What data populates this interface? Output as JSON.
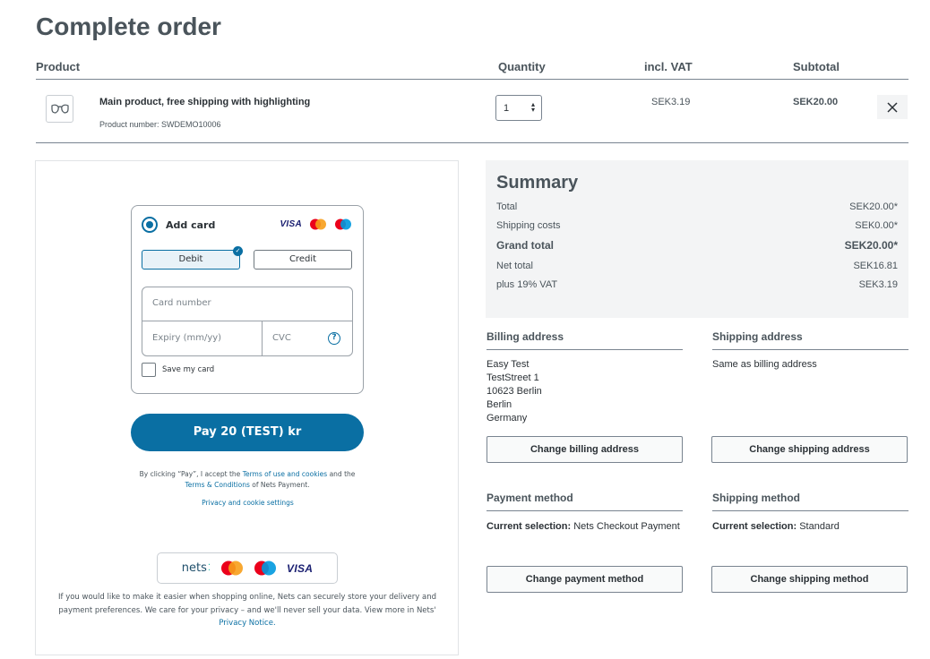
{
  "page": {
    "title": "Complete order"
  },
  "cart": {
    "headers": {
      "product": "Product",
      "quantity": "Quantity",
      "vat": "incl. VAT",
      "subtotal": "Subtotal"
    },
    "items": [
      {
        "name": "Main product, free shipping with highlighting",
        "number": "Product number: SWDEMO10006",
        "quantity": "1",
        "vat": "SEK3.19",
        "subtotal": "SEK20.00"
      }
    ]
  },
  "payment": {
    "add_card_label": "Add card",
    "card_brands": [
      "VISA",
      "Mastercard",
      "Maestro"
    ],
    "debit_label": "Debit",
    "credit_label": "Credit",
    "card_number_placeholder": "Card number",
    "expiry_placeholder": "Expiry (mm/yy)",
    "cvc_placeholder": "CVC",
    "save_card_label": "Save my card",
    "pay_button": "Pay 20 (TEST) kr",
    "terms_prefix": "By clicking “Pay”, I accept the",
    "terms_link": "Terms of use and cookies",
    "terms_mid": "and the",
    "conditions_link": "Terms & Conditions",
    "terms_suffix": "of Nets Payment.",
    "privacy_settings": "Privacy and cookie settings",
    "nets_logo": "nets",
    "visa_logo": "VISA",
    "notice_text": "If you would like to make it easier when shopping online, Nets can securely store your delivery and payment preferences. We care for your privacy – and we'll never sell your data. View more in Nets'",
    "notice_link": "Privacy Notice."
  },
  "summary": {
    "title": "Summary",
    "rows": [
      {
        "label": "Total",
        "value": "SEK20.00*"
      },
      {
        "label": "Shipping costs",
        "value": "SEK0.00*"
      },
      {
        "label": "Grand total",
        "value": "SEK20.00*"
      },
      {
        "label": "Net total",
        "value": "SEK16.81"
      },
      {
        "label": "plus 19% VAT",
        "value": "SEK3.19"
      }
    ]
  },
  "billing": {
    "title": "Billing address",
    "lines": [
      "Easy Test",
      "TestStreet 1",
      "10623 Berlin",
      "Berlin",
      "Germany"
    ],
    "button": "Change billing address"
  },
  "shipping": {
    "title": "Shipping address",
    "text": "Same as billing address",
    "button": "Change shipping address"
  },
  "payment_method": {
    "title": "Payment method",
    "key": "Current selection:",
    "value": "Nets Checkout Payment",
    "button": "Change payment method"
  },
  "shipping_method": {
    "title": "Shipping method",
    "key": "Current selection:",
    "value": "Standard",
    "button": "Change shipping method"
  }
}
